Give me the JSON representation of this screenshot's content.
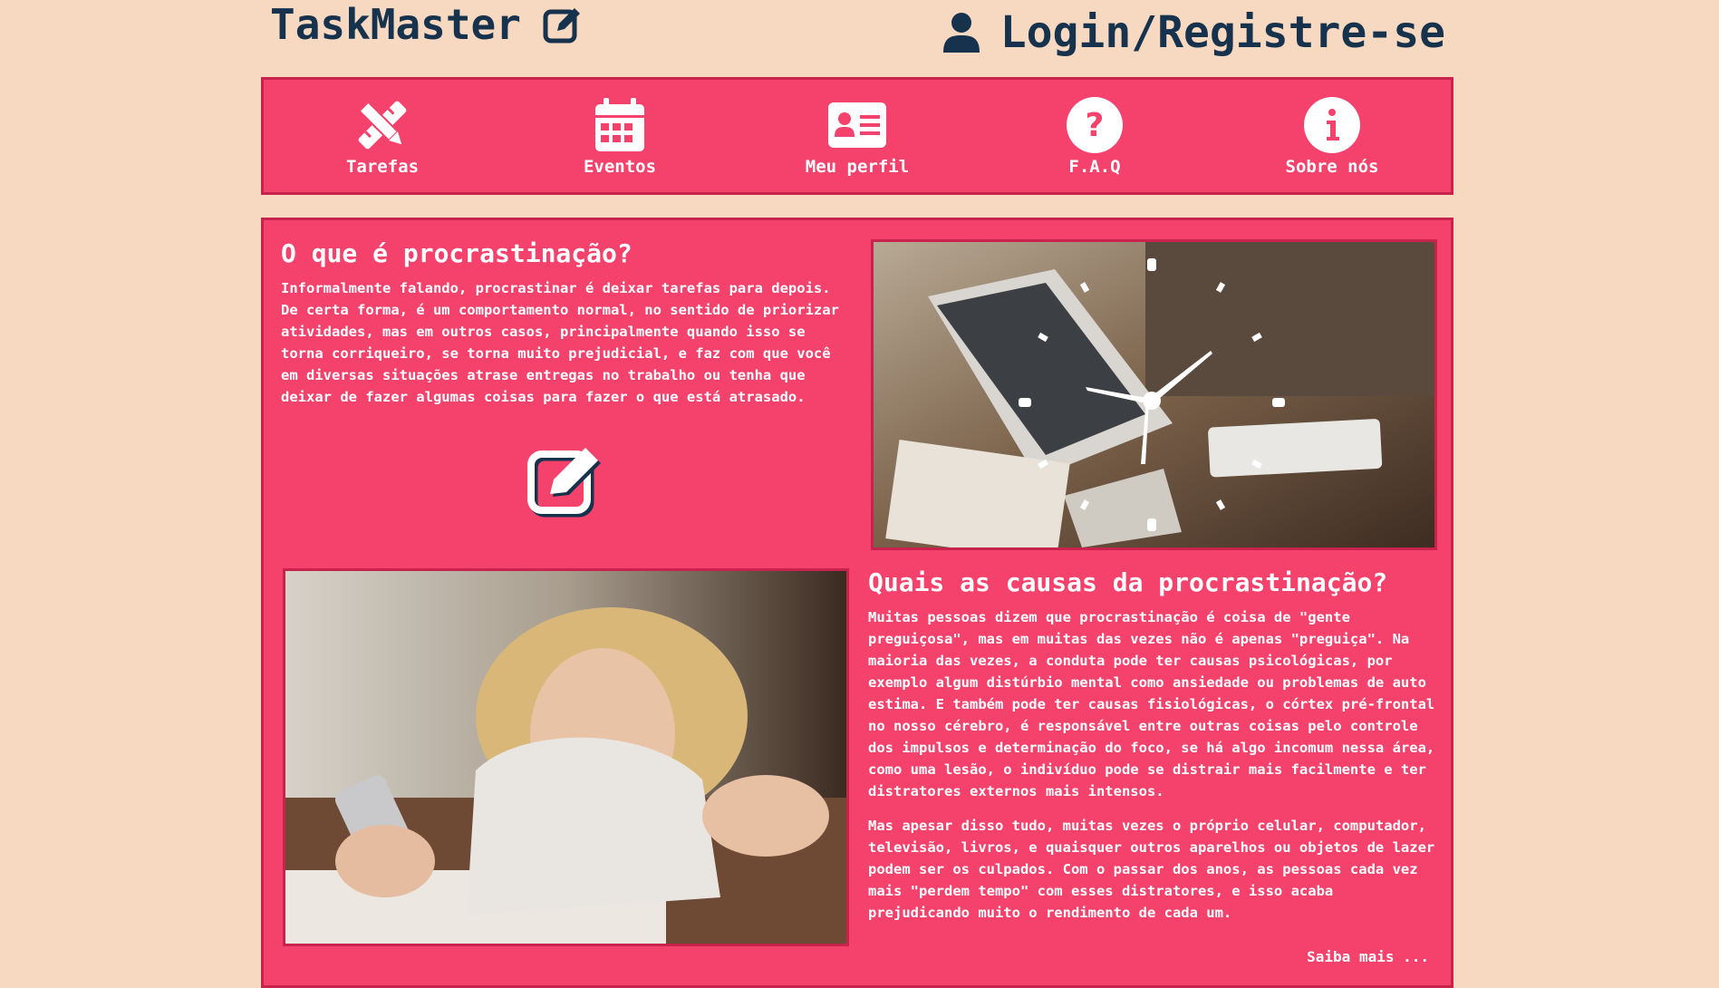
{
  "header": {
    "brand": "TaskMaster",
    "login_label": "Login/Registre-se"
  },
  "nav": {
    "items": [
      {
        "label": "Tarefas",
        "icon": "pencil-ruler-icon"
      },
      {
        "label": "Eventos",
        "icon": "calendar-icon"
      },
      {
        "label": "Meu perfil",
        "icon": "id-card-icon"
      },
      {
        "label": "F.A.Q",
        "icon": "question-circle-icon"
      },
      {
        "label": "Sobre nós",
        "icon": "info-circle-icon"
      }
    ]
  },
  "section1": {
    "title": "O que é procrastinação?",
    "text": "Informalmente falando, procrastinar é deixar tarefas para depois. De certa forma, é um comportamento normal, no sentido de priorizar atividades, mas em outros casos, principalmente quando isso se torna corriqueiro, se torna muito prejudicial, e faz com que você em diversas situações atrase entregas no trabalho ou tenha que deixar de fazer algumas coisas para fazer o que está atrasado."
  },
  "section2": {
    "title": "Quais as causas da procrastinação?",
    "text1": "Muitas pessoas dizem que procrastinação é coisa de \"gente preguiçosa\", mas em muitas das vezes não é apenas \"preguiça\". Na maioria das vezes, a conduta pode ter causas psicológicas, por exemplo algum distúrbio mental como ansiedade ou problemas de auto estima. E também pode ter causas fisiológicas, o córtex pré-frontal no nosso cérebro, é responsável entre outras coisas pelo controle dos impulsos e determinação do foco, se há algo incomum nessa área, como uma lesão, o indivíduo pode se distrair mais facilmente e ter distratores externos mais intensos.",
    "text2": "Mas apesar disso tudo, muitas vezes o próprio celular, computador, televisão, livros, e quaisquer outros aparelhos ou objetos de lazer podem ser os culpados. Com o passar dos anos, as pessoas cada vez mais \"perdem tempo\" com esses distratores, e isso acaba prejudicando muito o rendimento de cada um.",
    "more": "Saiba mais ..."
  },
  "colors": {
    "background": "#f7d9c1",
    "panel": "#f5426c",
    "border": "#c7234d",
    "brand_text": "#17324d"
  }
}
